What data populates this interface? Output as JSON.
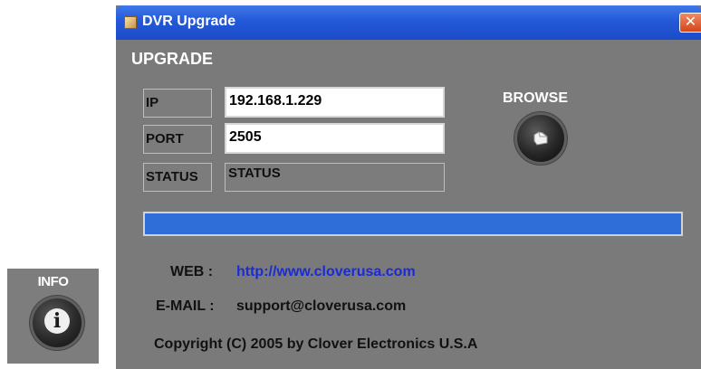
{
  "info_panel": {
    "label": "INFO",
    "icon": "info-icon"
  },
  "window": {
    "title": "DVR Upgrade",
    "close_glyph": "✕",
    "section_title": "UPGRADE",
    "fields": {
      "ip_label": "IP",
      "ip_value": "192.168.1.229",
      "port_label": "PORT",
      "port_value": "2505",
      "status_label": "STATUS",
      "status_value": "STATUS"
    },
    "browse": {
      "label": "BROWSE",
      "icon": "folder-icon"
    },
    "progress": {
      "value_percent": 100
    },
    "web_label": "WEB :",
    "web_url": "http://www.cloverusa.com",
    "email_label": "E-MAIL :",
    "email_value": "support@cloverusa.com",
    "copyright": "Copyright (C) 2005 by  Clover Electronics U.S.A"
  },
  "colors": {
    "titlebar": "#2358d8",
    "window_bg": "#7a7a7a",
    "progress": "#2f6ed8",
    "link": "#1a2bd6",
    "close": "#d6451c"
  }
}
